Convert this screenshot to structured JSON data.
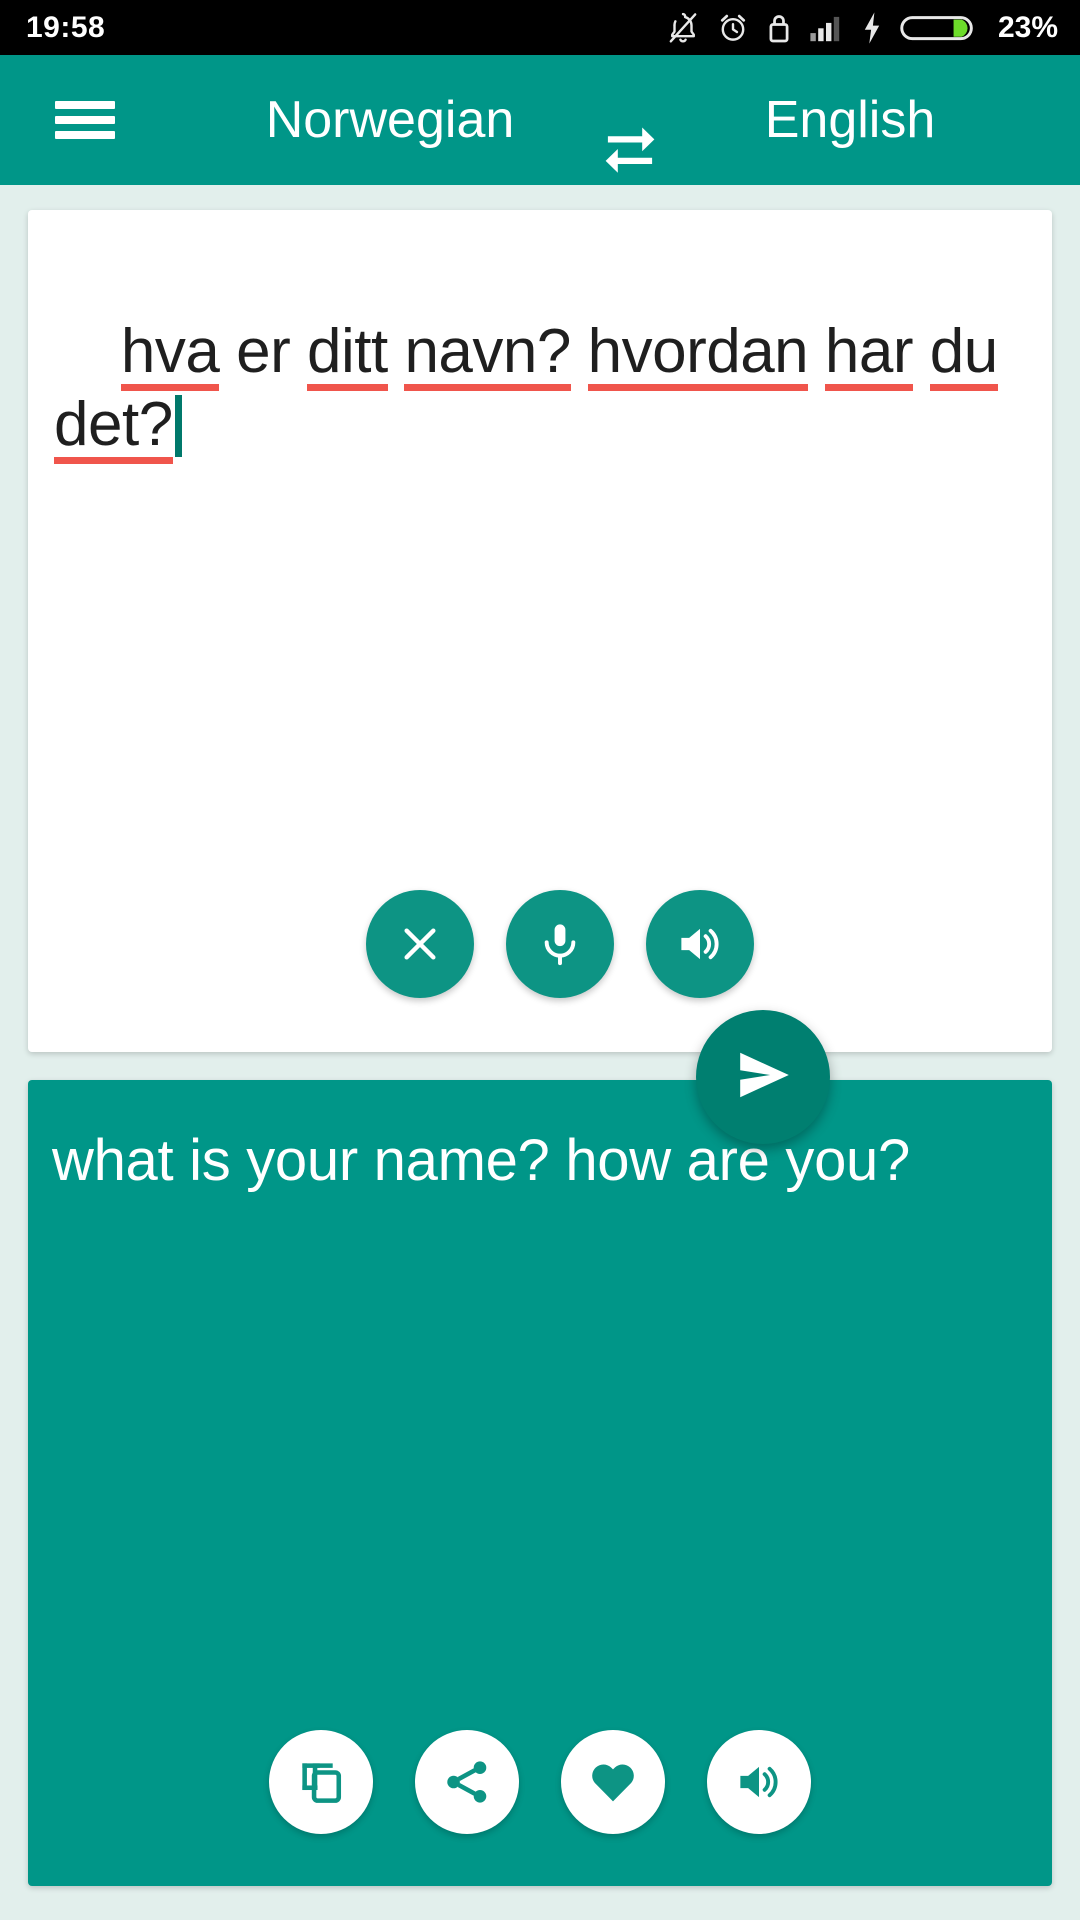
{
  "status_bar": {
    "time": "19:58",
    "battery_percent": "23%",
    "icons": [
      "bell-off-icon",
      "alarm-clock-icon",
      "lock-icon",
      "signal-bars-icon",
      "charging-bolt-icon",
      "battery-icon"
    ]
  },
  "app_bar": {
    "menu_icon": "hamburger-menu-icon",
    "source_language": "Norwegian",
    "swap_icon": "swap-languages-icon",
    "target_language": "English"
  },
  "source_panel": {
    "text": "hva er ditt navn? hvordan har du det?",
    "tokens": [
      {
        "text": "hva",
        "misspelled": true
      },
      {
        "text": "er",
        "misspelled": false
      },
      {
        "text": "ditt",
        "misspelled": true
      },
      {
        "text": "navn?",
        "misspelled": true
      },
      {
        "text": "hvordan",
        "misspelled": true
      },
      {
        "text": "har",
        "misspelled": true
      },
      {
        "text": "du",
        "misspelled": true
      },
      {
        "text": "det?",
        "misspelled": true
      }
    ],
    "caret_visible": true,
    "actions": [
      {
        "name": "clear-button",
        "icon": "close-icon"
      },
      {
        "name": "voice-input-button",
        "icon": "microphone-icon"
      },
      {
        "name": "speak-source-button",
        "icon": "speaker-icon"
      }
    ]
  },
  "send_button": {
    "name": "translate-send-button",
    "icon": "send-icon"
  },
  "result_panel": {
    "text": "what is your name? how are you?",
    "actions": [
      {
        "name": "copy-button",
        "icon": "copy-icon"
      },
      {
        "name": "share-button",
        "icon": "share-icon"
      },
      {
        "name": "favorite-button",
        "icon": "heart-icon"
      },
      {
        "name": "speak-result-button",
        "icon": "speaker-icon"
      }
    ]
  },
  "colors": {
    "primary_teal": "#009688",
    "dark_teal": "#007f70",
    "button_teal": "#0d9484",
    "page_background": "#e2efec",
    "status_bar_background": "#000000",
    "spell_underline": "#f0554c",
    "caret": "#00796b",
    "battery_fill": "#6ddc2a"
  }
}
